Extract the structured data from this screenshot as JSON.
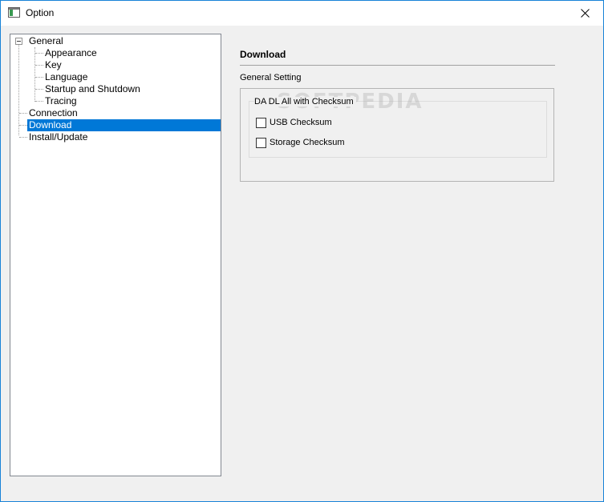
{
  "window": {
    "title": "Option"
  },
  "icons": {
    "app": "app-window-icon",
    "close": "close-icon",
    "expander": "tree-collapse-icon"
  },
  "tree": {
    "items": [
      {
        "label": "General",
        "level": 0,
        "expanded": true
      },
      {
        "label": "Appearance",
        "level": 1
      },
      {
        "label": "Key",
        "level": 1
      },
      {
        "label": "Language",
        "level": 1
      },
      {
        "label": "Startup and Shutdown",
        "level": 1
      },
      {
        "label": "Tracing",
        "level": 1
      },
      {
        "label": "Connection",
        "level": 0
      },
      {
        "label": "Download",
        "level": 0,
        "selected": true
      },
      {
        "label": "Install/Update",
        "level": 0
      }
    ]
  },
  "panel": {
    "title": "Download",
    "group_label": "General Setting",
    "subgroup_label": "DA DL All with Checksum",
    "checkboxes": [
      {
        "label": "USB Checksum",
        "checked": false
      },
      {
        "label": "Storage Checksum",
        "checked": false
      }
    ]
  },
  "watermark": "SOFTPEDIA",
  "colors": {
    "selection": "#0078d7",
    "border_accent": "#1883d7"
  }
}
